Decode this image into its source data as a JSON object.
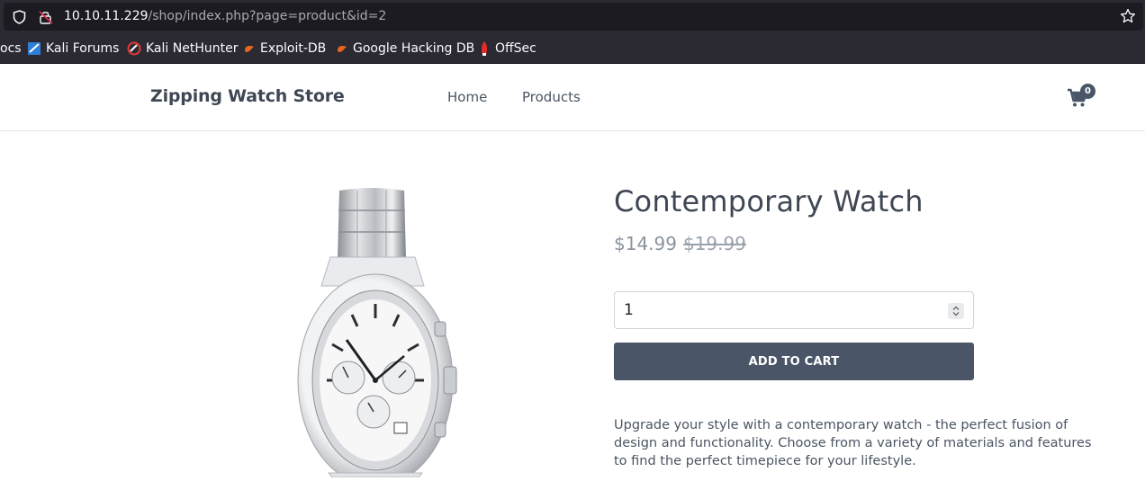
{
  "browser": {
    "url_host": "10.10.11.229",
    "url_path": "/shop/index.php?page=product&id=2",
    "bookmarks": [
      {
        "label": "ocs"
      },
      {
        "label": "Kali Forums"
      },
      {
        "label": "Kali NetHunter"
      },
      {
        "label": "Exploit-DB"
      },
      {
        "label": "Google Hacking DB"
      },
      {
        "label": "OffSec"
      }
    ]
  },
  "header": {
    "brand": "Zipping Watch Store",
    "nav": [
      "Home",
      "Products"
    ],
    "cart_count": "0"
  },
  "product": {
    "title": "Contemporary Watch",
    "price": "$14.99",
    "old_price": "$19.99",
    "quantity": "1",
    "add_to_cart_label": "ADD TO CART",
    "description": "Upgrade your style with a contemporary watch - the perfect fusion of design and functionality. Choose from a variety of materials and features to find the perfect timepiece for your lifestyle."
  }
}
